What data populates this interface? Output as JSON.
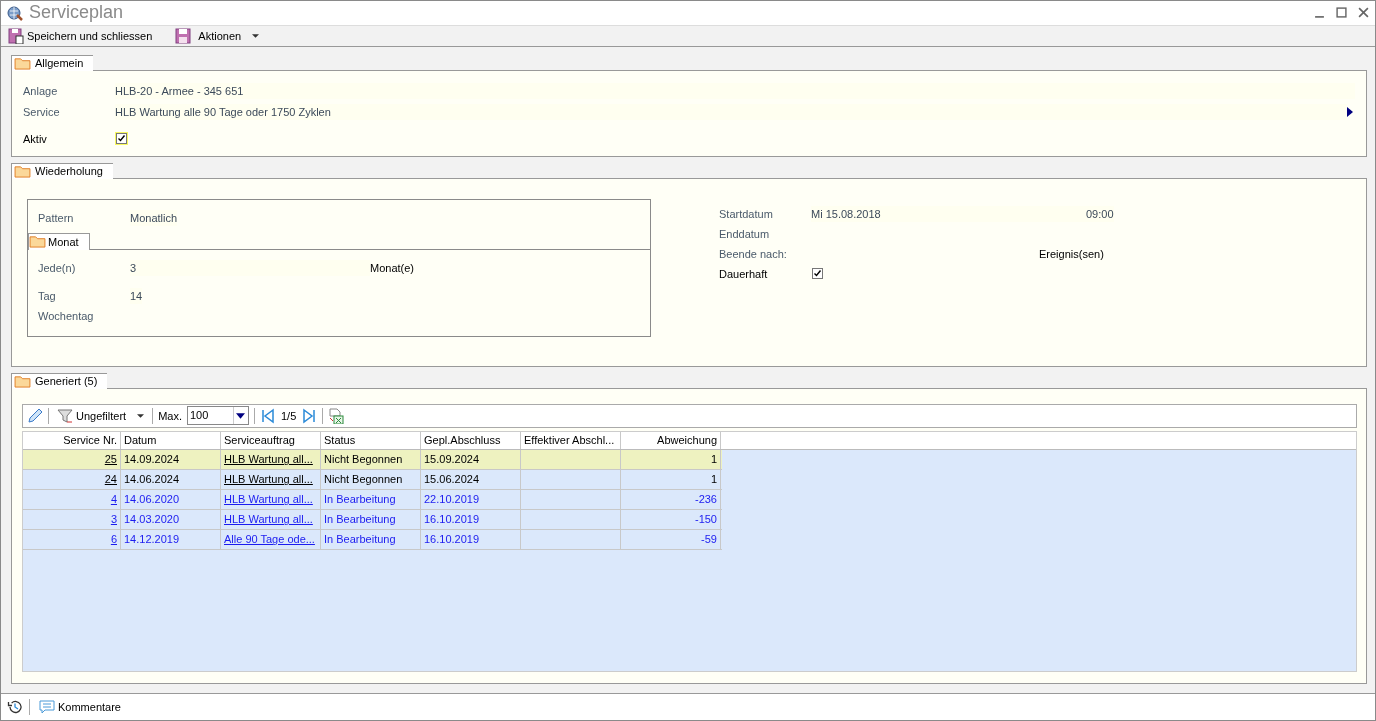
{
  "window": {
    "title": "Serviceplan"
  },
  "toolbar": [
    {
      "label": "Speichern und schliessen",
      "kind": "save_close"
    },
    {
      "label": "Aktionen",
      "kind": "menu"
    }
  ],
  "general": {
    "title": "Allgemein",
    "fields": [
      {
        "label": "Anlage",
        "value": "HLB-20 - Armee - 345 651"
      },
      {
        "label": "Service",
        "value": "HLB Wartung alle 90 Tage oder 1750 Zyklen"
      }
    ],
    "active": {
      "label": "Aktiv",
      "checked": true
    }
  },
  "repetition": {
    "title": "Wiederholung",
    "pattern": {
      "label": "Pattern",
      "value": "Monatlich"
    },
    "month_tab": "Monat",
    "every": {
      "label": "Jede(n)",
      "value": "3",
      "unit": "Monat(e)"
    },
    "day": {
      "label": "Tag",
      "value": "14"
    },
    "weekday": {
      "label": "Wochentag"
    },
    "start": {
      "label": "Startdatum",
      "value": "Mi 15.08.2018",
      "time": "09:00"
    },
    "end": {
      "label": "Enddatum"
    },
    "end_after": {
      "label": "Beende nach:",
      "unit": "Ereignis(sen)"
    },
    "permanent": {
      "label": "Dauerhaft",
      "checked": true
    }
  },
  "generated": {
    "title": "Generiert (5)",
    "filter": "Ungefiltert",
    "max_label": "Max.",
    "max_value": "100",
    "page": "1/5",
    "columns": [
      {
        "label": "Service Nr.",
        "kind": "link_number"
      },
      {
        "label": "Datum",
        "kind": "text"
      },
      {
        "label": "Serviceauftrag",
        "kind": "link"
      },
      {
        "label": "Status",
        "kind": "text"
      },
      {
        "label": "Gepl.Abschluss",
        "kind": "text"
      },
      {
        "label": "Effektiver Abschl...",
        "kind": "text"
      },
      {
        "label": "Abweichung",
        "kind": "number"
      }
    ],
    "rows": [
      {
        "selected": true,
        "color": "#000000",
        "cells": [
          "25",
          "14.09.2024",
          "HLB Wartung all...",
          "Nicht Begonnen",
          "15.09.2024",
          "",
          "1"
        ]
      },
      {
        "selected": false,
        "color": "#000000",
        "cells": [
          "24",
          "14.06.2024",
          "HLB Wartung all...",
          "Nicht Begonnen",
          "15.06.2024",
          "",
          "1"
        ]
      },
      {
        "selected": false,
        "color": "#1c1cf0",
        "cells": [
          "4",
          "14.06.2020",
          "HLB Wartung all...",
          "In Bearbeitung",
          "22.10.2019",
          "",
          "-236"
        ]
      },
      {
        "selected": false,
        "color": "#1c1cf0",
        "cells": [
          "3",
          "14.03.2020",
          "HLB Wartung all...",
          "In Bearbeitung",
          "16.10.2019",
          "",
          "-150"
        ]
      },
      {
        "selected": false,
        "color": "#1c1cf0",
        "cells": [
          "6",
          "14.12.2019",
          "Alle 90 Tage ode...",
          "In Bearbeitung",
          "16.10.2019",
          "",
          "-59"
        ]
      }
    ]
  },
  "status_bar": {
    "comments": "Kommentare"
  }
}
